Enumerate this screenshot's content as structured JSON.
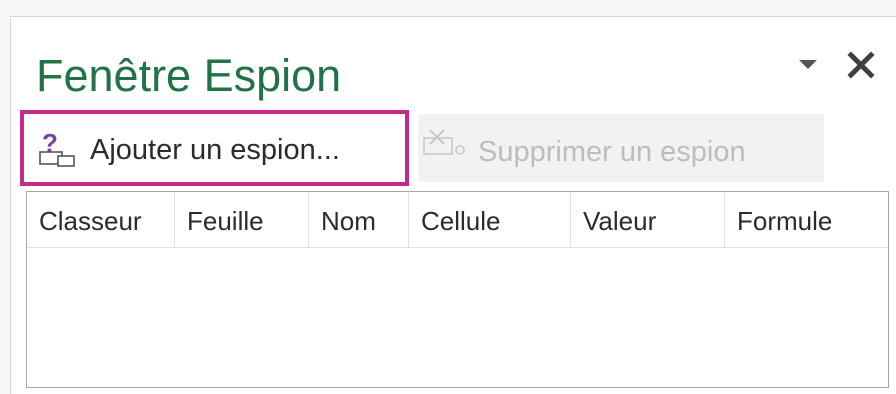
{
  "pane": {
    "title": "Fenêtre Espion"
  },
  "toolbar": {
    "add_label": "Ajouter un espion...",
    "remove_label": "Supprimer un espion",
    "add_icon": "add-watch-icon",
    "remove_icon": "delete-watch-icon"
  },
  "window_controls": {
    "options_icon": "chevron-down-icon",
    "close_icon": "close-icon"
  },
  "grid": {
    "columns": [
      "Classeur",
      "Feuille",
      "Nom",
      "Cellule",
      "Valeur",
      "Formule"
    ],
    "rows": []
  },
  "colors": {
    "title": "#217346",
    "highlight_border": "#c52a8b",
    "icon_question": "#7b3f9e",
    "disabled_text": "#bdbdbd"
  }
}
